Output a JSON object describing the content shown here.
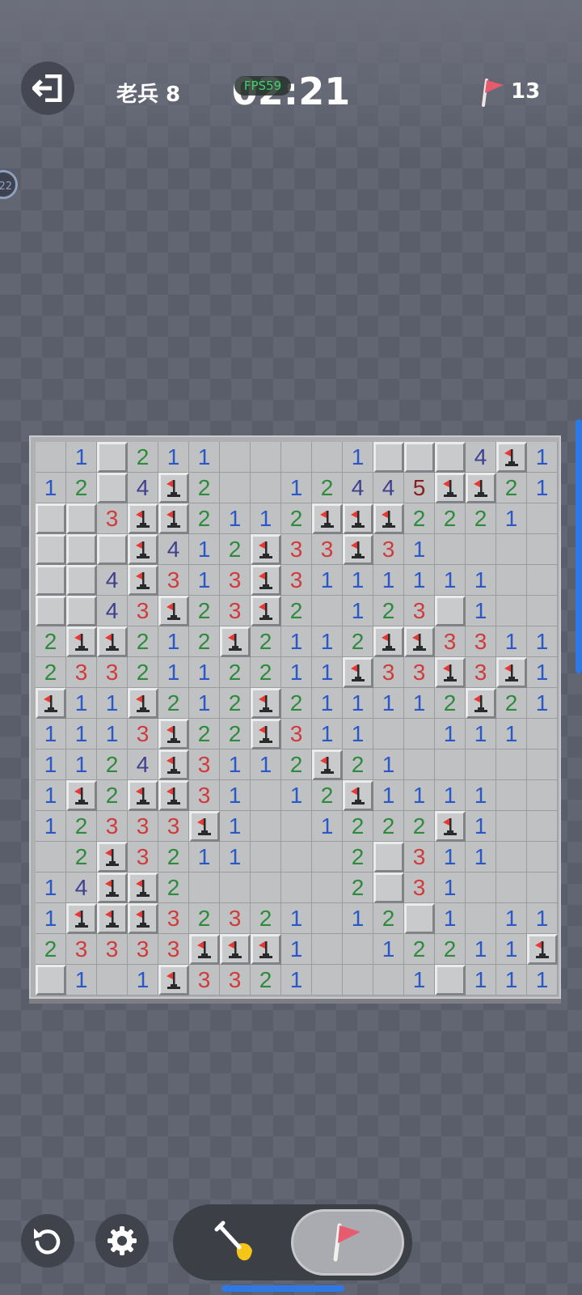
{
  "header": {
    "level_label": "老兵 8",
    "fps_label": "FPS59",
    "timer": "02:21",
    "flags_remaining": "13",
    "side_badge": "22"
  },
  "icons": {
    "exit": "exit-icon",
    "flag": "flag-icon",
    "restart": "restart-icon",
    "settings": "gear-icon",
    "dig": "shovel-icon"
  },
  "colors": {
    "n1": "#2b58c7",
    "n2": "#2e8b3c",
    "n3": "#d03b3b",
    "n4": "#3e3f8e",
    "n5": "#8a1f1f",
    "flag": "#e8424a",
    "accent": "#2f79e6"
  },
  "toolbar": {
    "mode_options": [
      "dig",
      "flag"
    ],
    "selected_mode": "flag"
  },
  "board": {
    "columns": 17,
    "rows_count": 18,
    "legend": "0=revealed empty, 1-8=number, U=unrevealed, F=flagged",
    "rows": [
      [
        "0",
        "1",
        "U",
        "2",
        "1",
        "1",
        "0",
        "0",
        "0",
        "0",
        "1",
        "U",
        "U",
        "U",
        "4",
        "F",
        "1"
      ],
      [
        "1",
        "2",
        "U",
        "4",
        "F",
        "2",
        "0",
        "0",
        "1",
        "2",
        "4",
        "4",
        "5",
        "F",
        "F",
        "2",
        "1"
      ],
      [
        "U",
        "U",
        "3",
        "F",
        "F",
        "2",
        "1",
        "1",
        "2",
        "F",
        "F",
        "F",
        "2",
        "2",
        "2",
        "1",
        "0"
      ],
      [
        "U",
        "U",
        "U",
        "F",
        "4",
        "1",
        "2",
        "F",
        "3",
        "3",
        "F",
        "3",
        "1",
        "0",
        "0",
        "0",
        "0"
      ],
      [
        "U",
        "U",
        "4",
        "F",
        "3",
        "1",
        "3",
        "F",
        "3",
        "1",
        "1",
        "1",
        "1",
        "1",
        "1",
        "0",
        "0"
      ],
      [
        "U",
        "U",
        "4",
        "3",
        "F",
        "2",
        "3",
        "F",
        "2",
        "0",
        "1",
        "2",
        "3",
        "U",
        "1",
        "0",
        "0"
      ],
      [
        "2",
        "F",
        "F",
        "2",
        "1",
        "2",
        "F",
        "2",
        "1",
        "1",
        "2",
        "F",
        "F",
        "3",
        "3",
        "1",
        "1"
      ],
      [
        "2",
        "3",
        "3",
        "2",
        "1",
        "1",
        "2",
        "2",
        "1",
        "1",
        "F",
        "3",
        "3",
        "F",
        "3",
        "F",
        "1"
      ],
      [
        "F",
        "1",
        "1",
        "F",
        "2",
        "1",
        "2",
        "F",
        "2",
        "1",
        "1",
        "1",
        "1",
        "2",
        "F",
        "2",
        "1"
      ],
      [
        "1",
        "1",
        "1",
        "3",
        "F",
        "2",
        "2",
        "F",
        "3",
        "1",
        "1",
        "0",
        "0",
        "1",
        "1",
        "1",
        "0"
      ],
      [
        "1",
        "1",
        "2",
        "4",
        "F",
        "3",
        "1",
        "1",
        "2",
        "F",
        "2",
        "1",
        "0",
        "0",
        "0",
        "0",
        "0"
      ],
      [
        "1",
        "F",
        "2",
        "F",
        "F",
        "3",
        "1",
        "0",
        "1",
        "2",
        "F",
        "1",
        "1",
        "1",
        "1",
        "0",
        "0"
      ],
      [
        "1",
        "2",
        "3",
        "3",
        "3",
        "F",
        "1",
        "0",
        "0",
        "1",
        "2",
        "2",
        "2",
        "F",
        "1",
        "0",
        "0"
      ],
      [
        "0",
        "2",
        "F",
        "3",
        "2",
        "1",
        "1",
        "0",
        "0",
        "0",
        "2",
        "U",
        "3",
        "1",
        "1",
        "0",
        "0"
      ],
      [
        "1",
        "4",
        "F",
        "F",
        "2",
        "0",
        "0",
        "0",
        "0",
        "0",
        "2",
        "U",
        "3",
        "1",
        "0",
        "0",
        "0"
      ],
      [
        "1",
        "F",
        "F",
        "F",
        "3",
        "2",
        "3",
        "2",
        "1",
        "0",
        "1",
        "2",
        "U",
        "1",
        "0",
        "1",
        "1"
      ],
      [
        "2",
        "3",
        "3",
        "3",
        "3",
        "F",
        "F",
        "F",
        "1",
        "0",
        "0",
        "1",
        "2",
        "2",
        "1",
        "1",
        "F"
      ],
      [
        "U",
        "1",
        "0",
        "1",
        "F",
        "3",
        "3",
        "2",
        "1",
        "0",
        "0",
        "0",
        "1",
        "U",
        "1",
        "1",
        "1"
      ]
    ]
  }
}
